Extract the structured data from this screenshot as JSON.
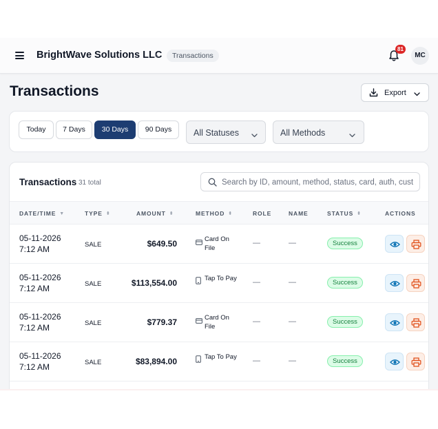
{
  "header": {
    "company": "BrightWave Solutions LLC",
    "breadcrumb_separator": "›",
    "breadcrumb_current": "Transactions",
    "notification_count": "81",
    "avatar_initials": "MC"
  },
  "page": {
    "title": "Transactions",
    "export_label": "Export"
  },
  "filters": {
    "ranges": [
      "Today",
      "7 Days",
      "30 Days",
      "90 Days"
    ],
    "active_range": "30 Days",
    "status_select": "All Statuses",
    "method_select": "All Methods"
  },
  "table": {
    "title": "Transactions",
    "count": "31 total",
    "search_placeholder": "Search by ID, amount, method, status, card, auth, cust",
    "columns": {
      "datetime": "DATE/TIME",
      "type": "TYPE",
      "amount": "AMOUNT",
      "method": "METHOD",
      "role": "ROLE",
      "name": "NAME",
      "status": "STATUS",
      "actions": "ACTIONS"
    },
    "rows": [
      {
        "date": "05-11-2026",
        "time": "7:12 AM",
        "type": "SALE",
        "amount": "$649.50",
        "method": "Card On File",
        "method_icon": "card-icon",
        "role": "—",
        "name": "—",
        "status": "Success"
      },
      {
        "date": "05-11-2026",
        "time": "7:12 AM",
        "type": "SALE",
        "amount": "$113,554.00",
        "method": "Tap To Pay",
        "method_icon": "phone-icon",
        "role": "—",
        "name": "—",
        "status": "Success"
      },
      {
        "date": "05-11-2026",
        "time": "7:12 AM",
        "type": "SALE",
        "amount": "$779.37",
        "method": "Card On File",
        "method_icon": "card-icon",
        "role": "—",
        "name": "—",
        "status": "Success"
      },
      {
        "date": "05-11-2026",
        "time": "7:12 AM",
        "type": "SALE",
        "amount": "$83,894.00",
        "method": "Tap To Pay",
        "method_icon": "phone-icon",
        "role": "—",
        "name": "—",
        "status": "Success"
      }
    ]
  },
  "colors": {
    "primary": "#1d3d72",
    "success_text": "#15803d",
    "success_bg": "#dcfce7",
    "badge": "#dc2626"
  }
}
